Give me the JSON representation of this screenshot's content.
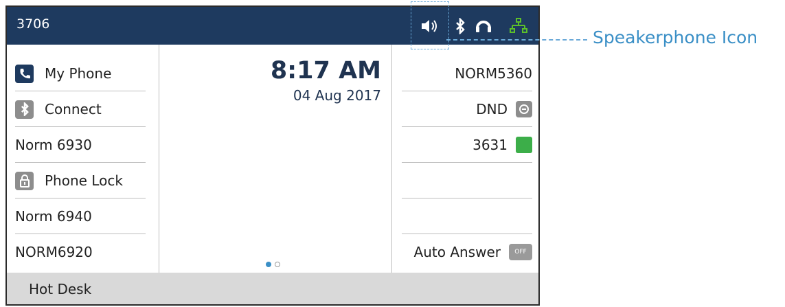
{
  "status_bar": {
    "extension": "3706"
  },
  "left_keys": [
    {
      "label": "My Phone",
      "icon": "phone-icon",
      "icon_bg": "#1e3a5f"
    },
    {
      "label": "Connect",
      "icon": "bluetooth-icon",
      "icon_bg": "#8d8d8d"
    },
    {
      "label": "Norm 6930"
    },
    {
      "label": "Phone Lock",
      "icon": "lock-icon",
      "icon_bg": "#8d8d8d"
    },
    {
      "label": "Norm 6940"
    },
    {
      "label": "NORM6920"
    }
  ],
  "clock": {
    "time": "8:17 AM",
    "date": "04 Aug 2017"
  },
  "right_keys": [
    {
      "label": "NORM5360"
    },
    {
      "label": "DND",
      "indicator": "dnd-icon"
    },
    {
      "label": "3631",
      "indicator": "presence-available-icon",
      "indicator_color": "#3cae49"
    },
    {
      "label": ""
    },
    {
      "label": ""
    },
    {
      "label": "Auto Answer",
      "indicator": "toggle-off-icon",
      "indicator_text": "OFF"
    }
  ],
  "pager": {
    "active_page": 1,
    "total_pages": 2
  },
  "softkeys": {
    "hot_desk": "Hot Desk"
  },
  "callout": {
    "label": "Speakerphone Icon"
  },
  "colors": {
    "header": "#1e3a5f",
    "accent": "#3a8fc6",
    "network": "#5cbf2a"
  }
}
